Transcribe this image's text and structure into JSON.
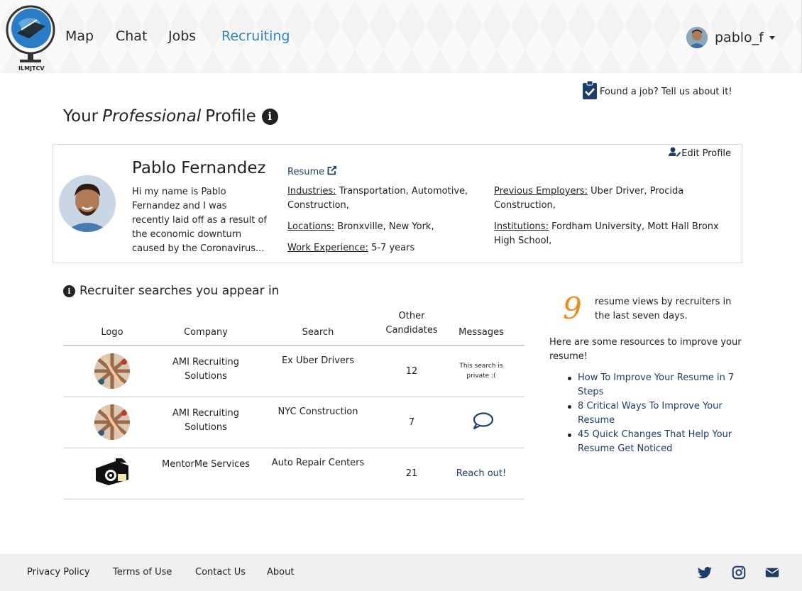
{
  "brand": {
    "name": "ILMJTCV"
  },
  "nav": {
    "links": [
      "Map",
      "Chat",
      "Jobs",
      "Recruiting"
    ],
    "active": "Recruiting",
    "user": "pablo_f"
  },
  "found_job": "Found a job? Tell us about it!",
  "page_title": {
    "pre": "Your",
    "em": "Professional",
    "post": "Profile"
  },
  "profile": {
    "edit_label": "Edit Profile",
    "name": "Pablo Fernandez",
    "bio": "Hi my name is Pablo Fernandez and I was recently laid off as a result of the economic downturn caused by the Coronavirus...",
    "resume_label": "Resume",
    "industries_label": "Industries:",
    "industries": "Transportation, Automotive, Construction,",
    "locations_label": "Locations:",
    "locations": "Bronxville, New York,",
    "experience_label": "Work Experience:",
    "experience": "5-7 years",
    "employers_label": "Previous Employers:",
    "employers": "Uber Driver, Procida Construction,",
    "institutions_label": "Institutions:",
    "institutions": "Fordham University, Mott Hall Bronx High School,"
  },
  "searches": {
    "title": "Recruiter searches you appear in",
    "columns": {
      "logo": "Logo",
      "company": "Company",
      "search": "Search",
      "candidates_1": "Other",
      "candidates_2": "Candidates",
      "messages": "Messages"
    },
    "rows": [
      {
        "company": "AMI Recruiting Solutions",
        "search": "Ex Uber Drivers",
        "candidates": "12",
        "message": "This search is private :("
      },
      {
        "company": "AMI Recruiting Solutions",
        "search": "NYC Construction",
        "candidates": "7",
        "message_icon": "chat-bubble-icon"
      },
      {
        "company": "MentorMe Services",
        "search": "Auto Repair Centers",
        "candidates": "21",
        "message": "Reach out!"
      }
    ]
  },
  "views": {
    "count": "9",
    "text": "resume views by recruiters in the last seven days.",
    "resources_intro": "Here are some resources to improve your resume!",
    "resources": [
      "How To Improve Your Resume in 7 Steps",
      "8 Critical Ways To Improve Your Resume",
      "45 Quick Changes That Help Your Resume Get Noticed"
    ]
  },
  "footer": {
    "links": [
      "Privacy Policy",
      "Terms of Use",
      "Contact Us",
      "About"
    ],
    "icons": [
      "twitter-icon",
      "instagram-icon",
      "email-icon"
    ]
  },
  "colors": {
    "accent": "#2f80c9",
    "link": "#1f3d6a",
    "highlight": "#f08a1c"
  }
}
